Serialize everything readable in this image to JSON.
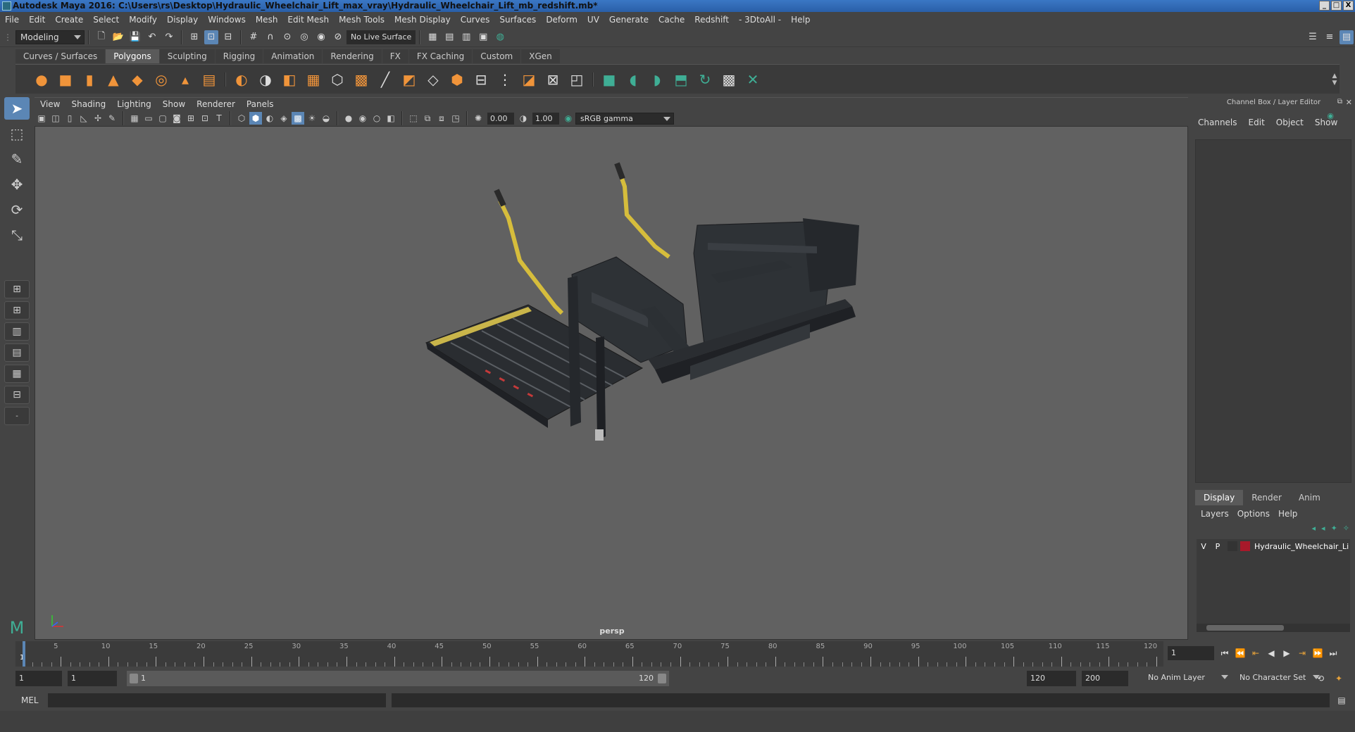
{
  "window": {
    "title": "Autodesk Maya 2016: C:\\Users\\rs\\Desktop\\Hydraulic_Wheelchair_Lift_max_vray\\Hydraulic_Wheelchair_Lift_mb_redshift.mb*",
    "min": "_",
    "max": "□",
    "close": "X"
  },
  "menu": [
    "File",
    "Edit",
    "Create",
    "Select",
    "Modify",
    "Display",
    "Windows",
    "Mesh",
    "Edit Mesh",
    "Mesh Tools",
    "Mesh Display",
    "Curves",
    "Surfaces",
    "Deform",
    "UV",
    "Generate",
    "Cache",
    "Redshift",
    "- 3DtoAll -",
    "Help"
  ],
  "status": {
    "mode": "Modeling",
    "live_surface": "No Live Surface"
  },
  "shelf": {
    "tabs": [
      "Curves / Surfaces",
      "Polygons",
      "Sculpting",
      "Rigging",
      "Animation",
      "Rendering",
      "FX",
      "FX Caching",
      "Custom",
      "XGen"
    ],
    "active_tab": 1
  },
  "panel": {
    "menu": [
      "View",
      "Shading",
      "Lighting",
      "Show",
      "Renderer",
      "Panels"
    ],
    "exposure": "0.00",
    "gamma": "1.00",
    "color_space": "sRGB gamma",
    "camera": "persp"
  },
  "channel_box": {
    "header": "Channel Box / Layer Editor",
    "menu": [
      "Channels",
      "Edit",
      "Object",
      "Show"
    ]
  },
  "layer_editor": {
    "tabs": [
      "Display",
      "Render",
      "Anim"
    ],
    "menu": [
      "Layers",
      "Options",
      "Help"
    ],
    "layer": {
      "v": "V",
      "p": "P",
      "name": "Hydraulic_Wheelchair_Li",
      "color": "#a8192a"
    }
  },
  "timeline": {
    "labels": [
      "5",
      "10",
      "15",
      "20",
      "25",
      "30",
      "35",
      "40",
      "45",
      "50",
      "55",
      "60",
      "65",
      "70",
      "75",
      "80",
      "85",
      "90",
      "95",
      "100",
      "105",
      "110",
      "115",
      "120"
    ],
    "current_frame": "1",
    "start_marker": "1"
  },
  "range": {
    "start": "1",
    "playback_start": "1",
    "range_start": "1",
    "range_end": "120",
    "playback_end": "120",
    "end": "200",
    "anim_layer": "No Anim Layer",
    "character_set": "No Character Set"
  },
  "cmd": {
    "label": "MEL"
  },
  "colors": {
    "accent": "#5b86b5",
    "orange": "#f0943a",
    "teal": "#3fae95"
  }
}
